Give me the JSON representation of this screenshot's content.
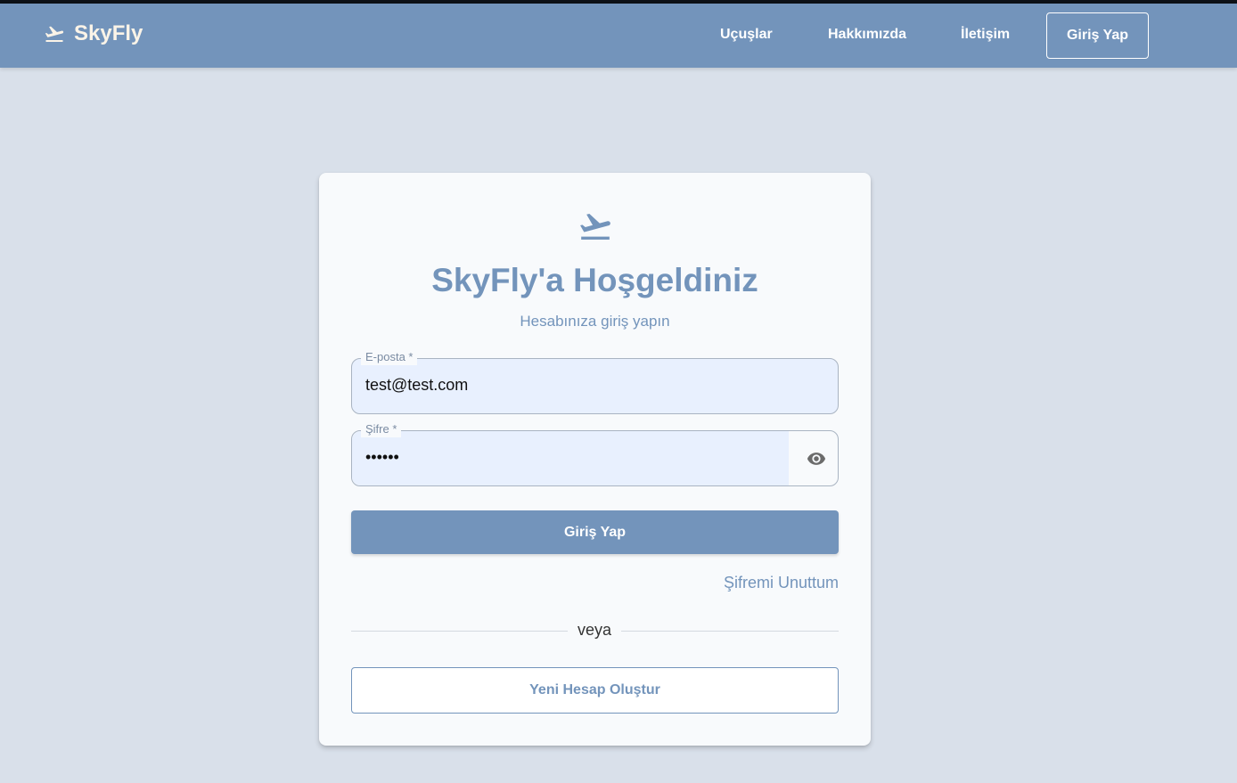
{
  "navbar": {
    "brand": "SkyFly",
    "links": [
      "Uçuşlar",
      "Hakkımızda",
      "İletişim"
    ],
    "login_label": "Giriş Yap"
  },
  "card": {
    "title": "SkyFly'a Hoşgeldiniz",
    "subtitle": "Hesabınıza giriş yapın",
    "email": {
      "label": "E-posta *",
      "value": "test@test.com"
    },
    "password": {
      "label": "Şifre *",
      "value": "••••••"
    },
    "submit_label": "Giriş Yap",
    "forgot_label": "Şifremi Unuttum",
    "divider_label": "veya",
    "register_label": "Yeni Hesap Oluştur"
  },
  "colors": {
    "brand": "#7394bb",
    "background": "#d9e0ea",
    "card": "#f8fafc"
  },
  "icons": {
    "brand": "flight-takeoff-icon",
    "card": "flight-takeoff-icon",
    "password_toggle": "eye-icon"
  }
}
